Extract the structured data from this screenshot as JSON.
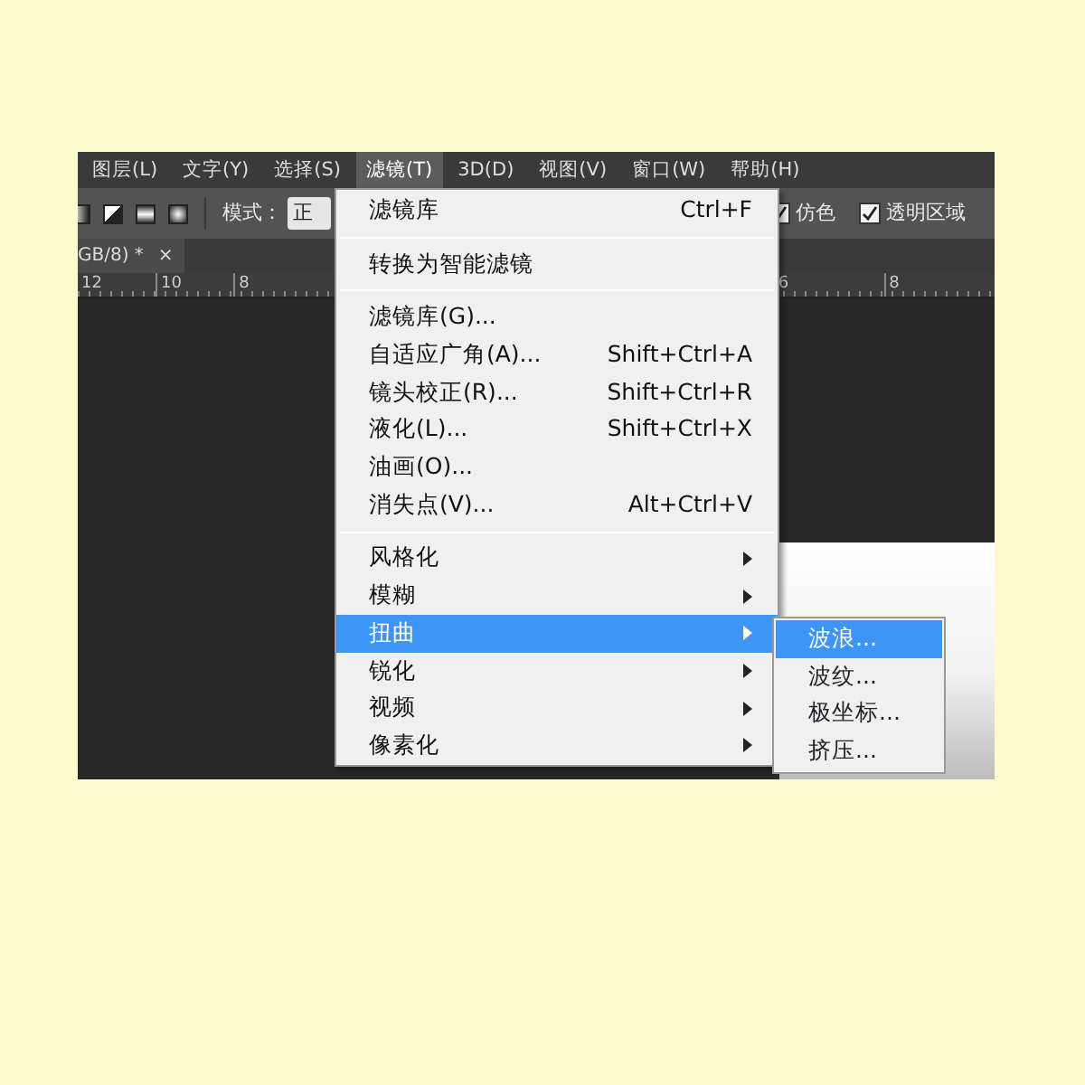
{
  "menubar": [
    {
      "label": "图层(L)",
      "selected": false
    },
    {
      "label": "文字(Y)",
      "selected": false
    },
    {
      "label": "选择(S)",
      "selected": false
    },
    {
      "label": "滤镜(T)",
      "selected": true
    },
    {
      "label": "3D(D)",
      "selected": false
    },
    {
      "label": "视图(V)",
      "selected": false
    },
    {
      "label": "窗口(W)",
      "selected": false
    },
    {
      "label": "帮助(H)",
      "selected": false
    }
  ],
  "options_bar": {
    "mode_label": "模式：",
    "mode_value": "正",
    "checkboxes": [
      {
        "label": "仿色",
        "checked": true
      },
      {
        "label": "透明区域",
        "checked": true
      }
    ]
  },
  "document_tab": {
    "title": "GB/8) *",
    "close": "×"
  },
  "ruler": {
    "left_marks": [
      "12",
      "10",
      "8"
    ],
    "right_marks": [
      "6",
      "8"
    ]
  },
  "filter_menu": [
    {
      "kind": "item",
      "label": "滤镜库",
      "shortcut": "Ctrl+F"
    },
    {
      "kind": "separator"
    },
    {
      "kind": "item",
      "label": "转换为智能滤镜"
    },
    {
      "kind": "separator"
    },
    {
      "kind": "item",
      "label": "滤镜库(G)..."
    },
    {
      "kind": "item",
      "label": "自适应广角(A)...",
      "shortcut": "Shift+Ctrl+A"
    },
    {
      "kind": "item",
      "label": "镜头校正(R)...",
      "shortcut": "Shift+Ctrl+R"
    },
    {
      "kind": "item",
      "label": "液化(L)...",
      "shortcut": "Shift+Ctrl+X"
    },
    {
      "kind": "item",
      "label": "油画(O)..."
    },
    {
      "kind": "item",
      "label": "消失点(V)...",
      "shortcut": "Alt+Ctrl+V"
    },
    {
      "kind": "separator"
    },
    {
      "kind": "submenu",
      "label": "风格化",
      "selected": false
    },
    {
      "kind": "submenu",
      "label": "模糊",
      "selected": false
    },
    {
      "kind": "submenu",
      "label": "扭曲",
      "selected": true
    },
    {
      "kind": "submenu",
      "label": "锐化",
      "selected": false
    },
    {
      "kind": "submenu",
      "label": "视频",
      "selected": false
    },
    {
      "kind": "submenu",
      "label": "像素化",
      "selected": false
    }
  ],
  "distort_submenu": [
    {
      "label": "波浪...",
      "selected": true
    },
    {
      "label": "波纹...",
      "selected": false
    },
    {
      "label": "极坐标...",
      "selected": false
    },
    {
      "label": "挤压...",
      "selected": false
    }
  ]
}
